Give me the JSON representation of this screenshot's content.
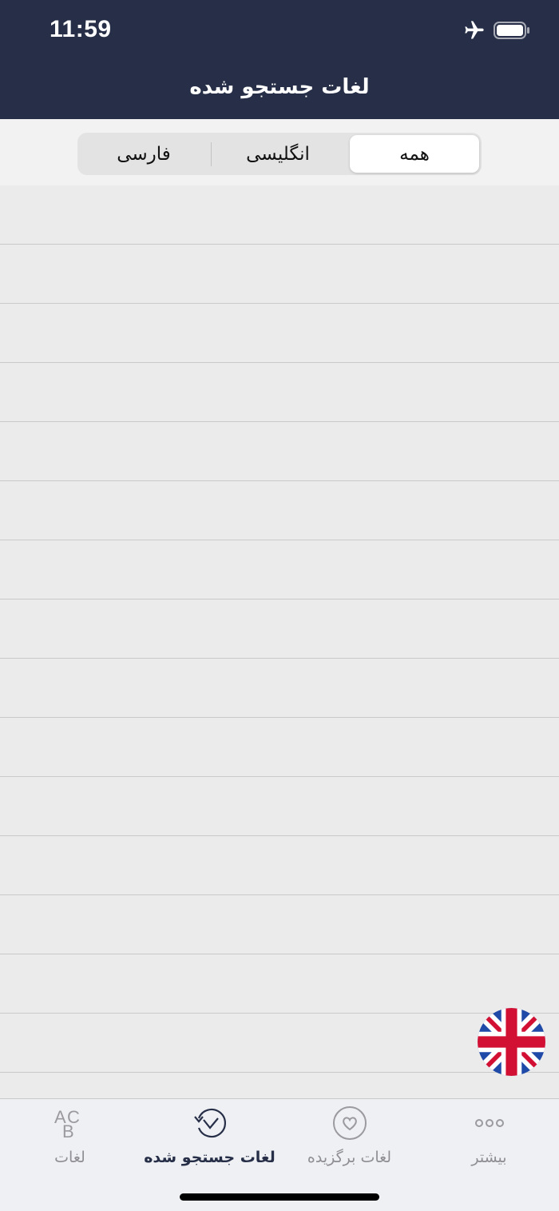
{
  "status_bar": {
    "time": "11:59",
    "icons": [
      "airplane-icon",
      "battery-icon"
    ]
  },
  "nav": {
    "title": "لغات جستجو شده"
  },
  "segments": {
    "all": "همه",
    "english": "انگلیسی",
    "persian": "فارسی",
    "selected": "all"
  },
  "list": {
    "row_count": 15
  },
  "floating_button": {
    "icon": "uk-flag-icon"
  },
  "tabbar": {
    "tabs": [
      {
        "label": "لغات",
        "icon": "abc-icon"
      },
      {
        "label": "لغات جستجو شده",
        "icon": "history-icon",
        "active": true
      },
      {
        "label": "لغات برگزیده",
        "icon": "heart-icon"
      },
      {
        "label": "بیشتر",
        "icon": "more-dots-icon"
      }
    ]
  },
  "colors": {
    "header": "#262f47",
    "background": "#ebebeb",
    "tab_inactive": "#8e8e93",
    "tab_active": "#262f47"
  }
}
